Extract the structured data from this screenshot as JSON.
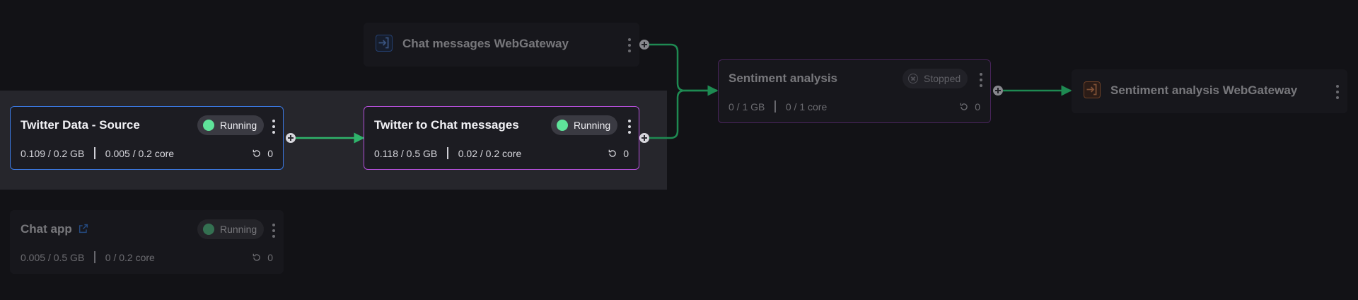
{
  "nodes": {
    "twitter_source": {
      "title": "Twitter Data - Source",
      "status": "Running",
      "memory": "0.109 / 0.2 GB",
      "cpu": "0.005 / 0.2 core",
      "restarts": "0"
    },
    "twitter_to_chat": {
      "title": "Twitter to Chat messages",
      "status": "Running",
      "memory": "0.118 / 0.5 GB",
      "cpu": "0.02 / 0.2 core",
      "restarts": "0"
    },
    "chat_app": {
      "title": "Chat app",
      "status": "Running",
      "memory": "0.005 / 0.5 GB",
      "cpu": "0 / 0.2 core",
      "restarts": "0"
    },
    "sentiment": {
      "title": "Sentiment analysis",
      "status": "Stopped",
      "memory": "0 / 1 GB",
      "cpu": "0 / 1 core",
      "restarts": "0"
    },
    "chat_gateway": {
      "title": "Chat messages WebGateway"
    },
    "sentiment_gateway": {
      "title": "Sentiment analysis WebGateway"
    }
  },
  "colors": {
    "background": "#121216",
    "edge": "#2fb46b",
    "selected_source_border": "#3b78e0",
    "selected_transform_border": "#b44fd9",
    "running_dot": "#5fe39a",
    "gateway_in_icon": "#3b78e0",
    "gateway_out_icon": "#e07a3b"
  },
  "icons": {
    "kebab": "more-vertical-icon",
    "restart": "restart-icon",
    "external_link": "external-link-icon",
    "gateway_in": "gateway-input-icon",
    "gateway_out": "gateway-output-icon",
    "port": "add-port-icon"
  }
}
